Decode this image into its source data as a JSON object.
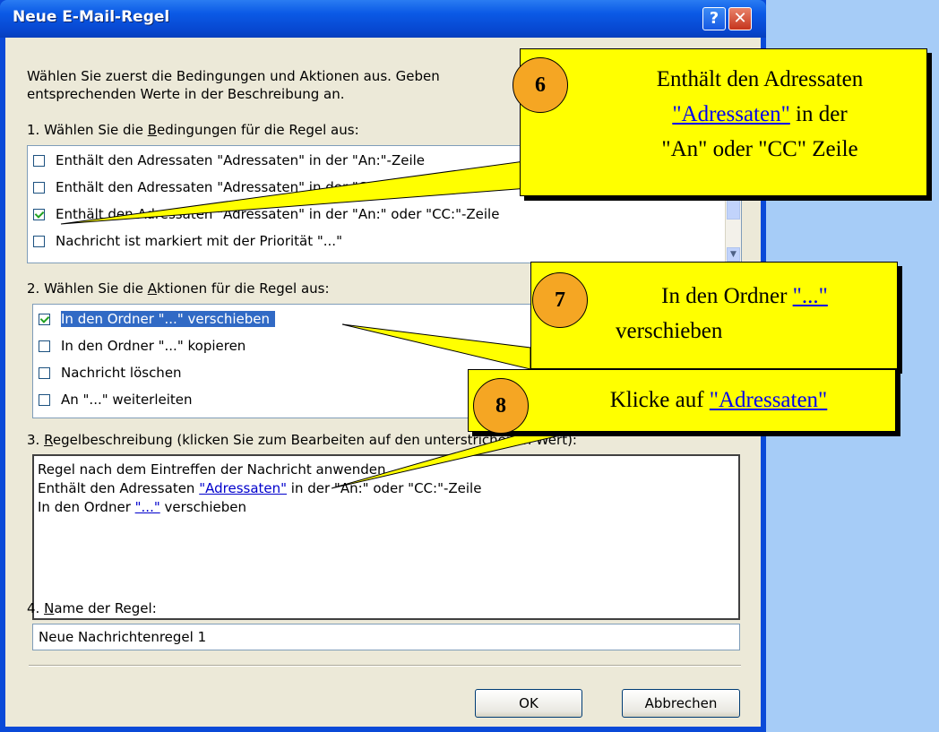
{
  "window": {
    "title": "Neue E-Mail-Regel",
    "help_button": "?",
    "close_button": "✕"
  },
  "intro": {
    "line1": "Wählen Sie zuerst die Bedingungen und Aktionen aus. Geben",
    "line2": "entsprechenden Werte in der Beschreibung an."
  },
  "conditions": {
    "heading_pre": "1. Wählen Sie die ",
    "heading_key": "B",
    "heading_post": "edingungen für die Regel aus:",
    "items": [
      {
        "label": "Enthält den Adressaten \"Adressaten\" in der \"An:\"-Zeile",
        "checked": false
      },
      {
        "label": "Enthält den Adressaten \"Adressaten\" in der \"CC:\"-Zeile",
        "checked": false
      },
      {
        "label": "Enthält den Adressaten \"Adressaten\" in der \"An:\" oder \"CC:\"-Zeile",
        "checked": true
      },
      {
        "label": "Nachricht ist markiert mit der Priorität \"...\"",
        "checked": false
      }
    ]
  },
  "actions": {
    "heading_pre": "2. Wählen Sie die ",
    "heading_key": "A",
    "heading_post": "ktionen für die Regel aus:",
    "items": [
      {
        "label": "In den Ordner \"...\" verschieben",
        "checked": true,
        "selected": true
      },
      {
        "label": "In den Ordner \"...\" kopieren",
        "checked": false
      },
      {
        "label": "Nachricht löschen",
        "checked": false
      },
      {
        "label": "An \"...\" weiterleiten",
        "checked": false
      }
    ]
  },
  "description": {
    "heading_pre": "3. ",
    "heading_key": "R",
    "heading_post": "egelbeschreibung (klicken Sie zum Bearbeiten auf den unterstrichenen Wert):",
    "line1": "Regel nach dem Eintreffen der Nachricht anwenden.",
    "line2_pre": "Enthält den Adressaten ",
    "line2_link": "\"Adressaten\"",
    "line2_post": " in der \"An:\" oder \"CC:\"-Zeile",
    "line3_pre": "In den Ordner ",
    "line3_link": "\"...\"",
    "line3_post": " verschieben"
  },
  "rule_name": {
    "label_pre": "4. ",
    "label_key": "N",
    "label_post": "ame der Regel:",
    "value": "Neue Nachrichtenregel 1"
  },
  "buttons": {
    "ok": "OK",
    "cancel": "Abbrechen"
  },
  "callouts": [
    {
      "number": "6",
      "line1": "Enthält den Adressaten",
      "line2_link": "\"Adressaten\"",
      "line2_post": " in der",
      "line3": "\"An\" oder \"CC\" Zeile"
    },
    {
      "number": "7",
      "line1_pre": "In den Ordner ",
      "line1_link": "\"...\"",
      "line2": "verschieben"
    },
    {
      "number": "8",
      "line1_pre": "Klicke auf ",
      "line1_link": "\"Adressaten\""
    }
  ],
  "colors": {
    "window_frame": "#0a4ad8",
    "dialog_face": "#ece9d8",
    "selection": "#316ac5",
    "callout_fill": "#ffff00",
    "badge_fill": "#f5a623",
    "page_background": "#a6ccf7"
  }
}
